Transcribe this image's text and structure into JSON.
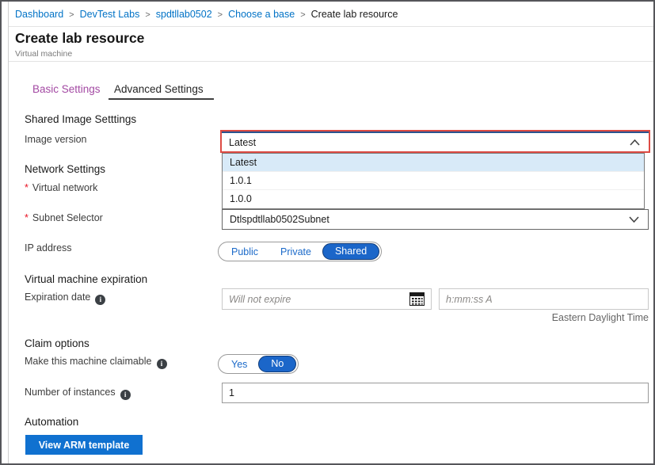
{
  "required_marker": "*",
  "breadcrumb": {
    "separator": ">",
    "items": [
      {
        "label": "Dashboard"
      },
      {
        "label": "DevTest Labs"
      },
      {
        "label": "spdtllab0502"
      },
      {
        "label": "Choose a base"
      },
      {
        "label": "Create lab resource"
      }
    ]
  },
  "header": {
    "title": "Create lab resource",
    "subtitle": "Virtual machine"
  },
  "tabs": {
    "basic": "Basic Settings",
    "advanced": "Advanced Settings",
    "active": "Advanced Settings"
  },
  "sections": {
    "shared_image": {
      "title": "Shared Image Setttings",
      "image_version_label": "Image version",
      "image_version_value": "Latest",
      "dropdown_options": [
        "Latest",
        "1.0.1",
        "1.0.0"
      ],
      "dropdown_selected": "Latest"
    },
    "network": {
      "title": "Network Settings",
      "virtual_network_label": "Virtual network",
      "subnet_label": "Subnet Selector",
      "subnet_value": "Dtlspdtllab0502Subnet",
      "ip_label": "IP address",
      "ip_options": [
        "Public",
        "Private",
        "Shared"
      ],
      "ip_selected": "Shared"
    },
    "expiration": {
      "title": "Virtual machine expiration",
      "date_label": "Expiration date",
      "date_placeholder": "Will not expire",
      "time_placeholder": "h:mm:ss A",
      "timezone": "Eastern Daylight Time"
    },
    "claim": {
      "title": "Claim options",
      "claimable_label": "Make this machine claimable",
      "claim_options": [
        "Yes",
        "No"
      ],
      "claim_selected": "No",
      "instances_label": "Number of instances",
      "instances_value": "1"
    },
    "automation": {
      "title": "Automation",
      "button_label": "View ARM template"
    }
  },
  "icons": {
    "info": "i"
  },
  "colors": {
    "breadcrumb_link": "#0072c6",
    "tab_inactive_purple": "#a349a3",
    "focus_highlight_red": "#dd4b44",
    "select_focus_navy": "#2a548f",
    "dropdown_highlight": "#d8eaf8",
    "toggle_selected_blue": "#1b66c9",
    "toggle_text_blue": "#1b6ac9",
    "button_blue": "#1071d0",
    "required_red": "#e81123"
  }
}
